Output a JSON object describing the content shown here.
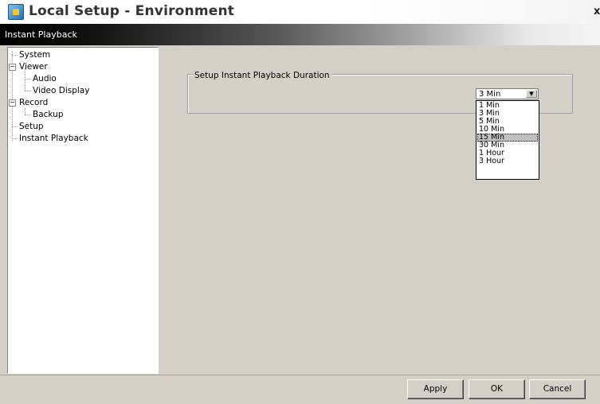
{
  "window": {
    "title": "Local Setup - Environment",
    "close_label": "x"
  },
  "header": {
    "section": "Instant Playback"
  },
  "tree": {
    "system": "System",
    "viewer": "Viewer",
    "audio": "Audio",
    "video_display": "Video Display",
    "record": "Record",
    "backup": "Backup",
    "setup": "Setup",
    "instant_playback": "Instant Playback",
    "collapse_symbol": "−"
  },
  "group": {
    "label": "Setup Instant Playback Duration"
  },
  "duration": {
    "selected": "3 Min",
    "arrow": "▼",
    "options": [
      "1 Min",
      "3 Min",
      "5 Min",
      "10 Min",
      "15 Min",
      "30 Min",
      "1 Hour",
      "3 Hour"
    ],
    "highlighted": "15 Min"
  },
  "buttons": {
    "apply": "Apply",
    "ok": "OK",
    "cancel": "Cancel"
  }
}
